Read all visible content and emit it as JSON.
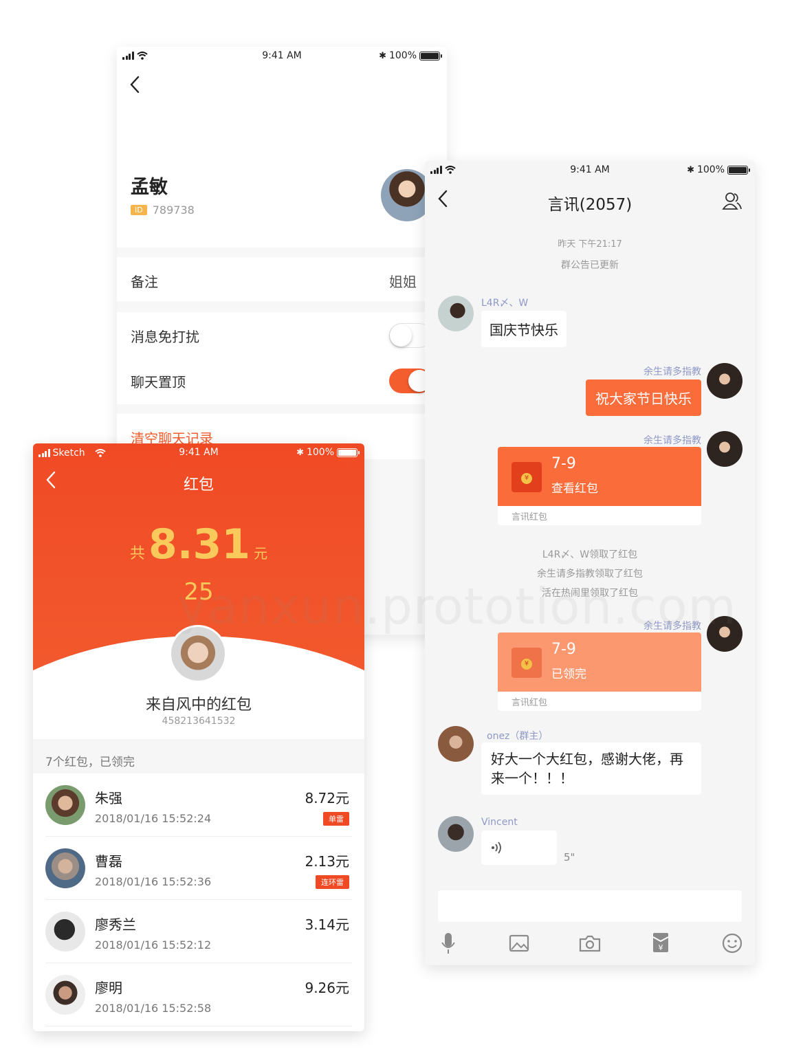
{
  "contact_screen": {
    "status": {
      "time": "9:41 AM",
      "battery": "100%"
    },
    "name": "孟敏",
    "id_tag": "ID",
    "id_value": "789738",
    "remark_label": "备注",
    "remark_value": "姐姐",
    "dnd_label": "消息免打扰",
    "dnd_on": false,
    "pin_label": "聊天置顶",
    "pin_on": true,
    "clear_label": "清空聊天记录",
    "accent": "#f45d2d"
  },
  "chat_screen": {
    "status": {
      "time": "9:41 AM",
      "battery": "100%"
    },
    "title": "言讯(2057)",
    "sys_time": "昨天 下午21:17",
    "sys_notice": "群公告已更新",
    "msg1": {
      "nick": "L4R〆、W",
      "text": "国庆节快乐"
    },
    "msg2": {
      "nick": "余生请多指教",
      "text": "祝大家节日快乐"
    },
    "rp1": {
      "nick": "余生请多指教",
      "title": "7-9",
      "status": "查看红包",
      "footer": "言讯红包"
    },
    "claims": [
      "L4R〆、W领取了红包",
      "余生请多指教领取了红包",
      "活在热闹里领取了红包"
    ],
    "rp2": {
      "nick": "余生请多指教",
      "title": "7-9",
      "status": "已领完",
      "footer": "言讯红包"
    },
    "msg3": {
      "nick": "onez（群主）",
      "line1": "好大一个大红包，感谢大佬，再",
      "line2": "来一个！！！"
    },
    "msg4": {
      "nick": "Vincent",
      "duration": "5\""
    },
    "toolbar": [
      "mic-icon",
      "image-icon",
      "camera-icon",
      "red-packet-icon",
      "emoji-icon"
    ],
    "bubble_color": "#fb6c3b"
  },
  "redpacket_screen": {
    "status": {
      "carrier": "Sketch",
      "time": "9:41 AM",
      "battery": "100%"
    },
    "title": "红包",
    "total_prefix": "共",
    "total_amount": "8.31",
    "total_unit": "元",
    "count_number": "25",
    "sender": "来自风中的红包",
    "sender_id": "458213641532",
    "summary": "7个红包，已领完",
    "rows": [
      {
        "name": "朱强",
        "time": "2018/01/16 15:52:24",
        "amount": "8.72元",
        "tag": "单雷"
      },
      {
        "name": "曹磊",
        "time": "2018/01/16 15:52:36",
        "amount": "2.13元",
        "tag": "连环雷"
      },
      {
        "name": "廖秀兰",
        "time": "2018/01/16 15:52:12",
        "amount": "3.14元",
        "tag": ""
      },
      {
        "name": "廖明",
        "time": "2018/01/16 15:52:58",
        "amount": "9.26元",
        "tag": ""
      }
    ],
    "gold": "#f9c95c"
  },
  "watermark": "yanxun.prototion.com"
}
